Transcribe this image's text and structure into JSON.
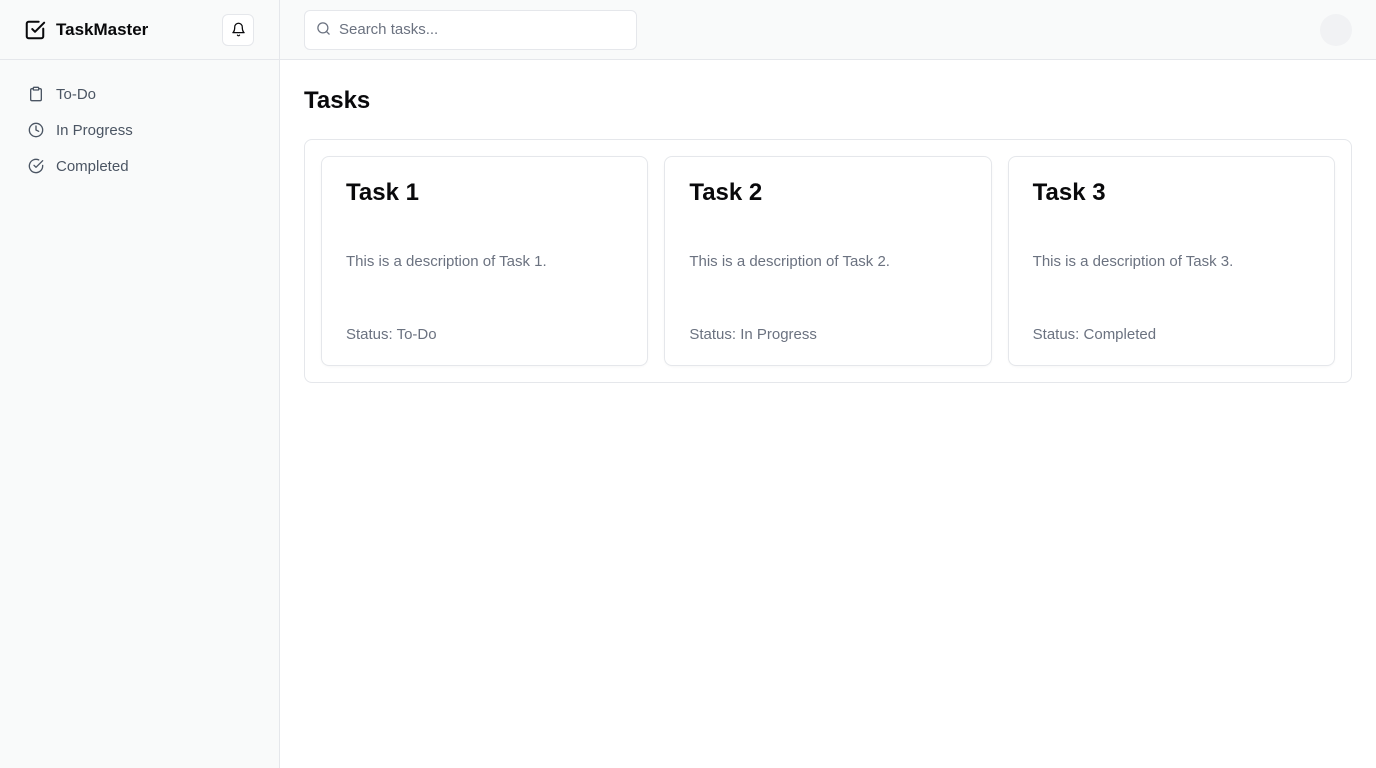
{
  "app": {
    "name": "TaskMaster"
  },
  "sidebar": {
    "items": [
      {
        "label": "To-Do",
        "icon": "clipboard-icon"
      },
      {
        "label": "In Progress",
        "icon": "clock-icon"
      },
      {
        "label": "Completed",
        "icon": "check-circle-icon"
      }
    ]
  },
  "search": {
    "placeholder": "Search tasks..."
  },
  "page": {
    "title": "Tasks"
  },
  "tasks": [
    {
      "title": "Task 1",
      "description": "This is a description of Task 1.",
      "status": "Status: To-Do"
    },
    {
      "title": "Task 2",
      "description": "This is a description of Task 2.",
      "status": "Status: In Progress"
    },
    {
      "title": "Task 3",
      "description": "This is a description of Task 3.",
      "status": "Status: Completed"
    }
  ],
  "colors": {
    "sidebar_bg": "#f9fafa",
    "border": "#e5e7eb",
    "text_primary": "#09090b",
    "text_muted": "#6b7280"
  }
}
